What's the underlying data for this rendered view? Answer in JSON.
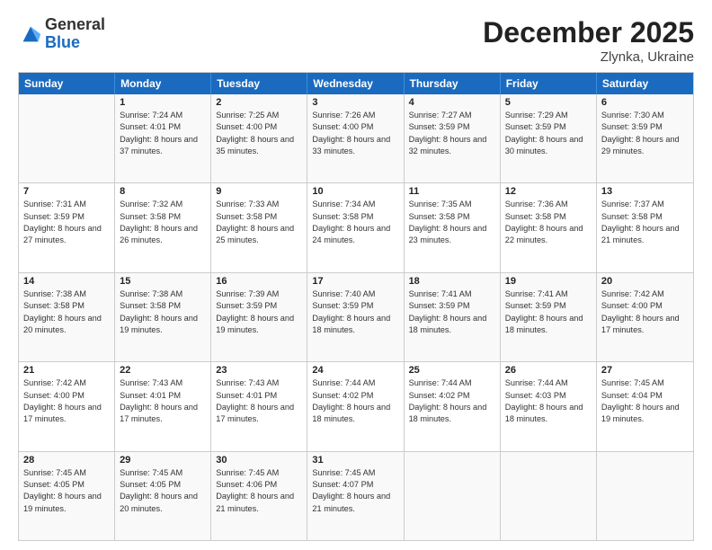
{
  "logo": {
    "general": "General",
    "blue": "Blue"
  },
  "title": "December 2025",
  "subtitle": "Zlynka, Ukraine",
  "header_days": [
    "Sunday",
    "Monday",
    "Tuesday",
    "Wednesday",
    "Thursday",
    "Friday",
    "Saturday"
  ],
  "weeks": [
    [
      {
        "day": "",
        "sunrise": "",
        "sunset": "",
        "daylight": ""
      },
      {
        "day": "1",
        "sunrise": "Sunrise: 7:24 AM",
        "sunset": "Sunset: 4:01 PM",
        "daylight": "Daylight: 8 hours and 37 minutes."
      },
      {
        "day": "2",
        "sunrise": "Sunrise: 7:25 AM",
        "sunset": "Sunset: 4:00 PM",
        "daylight": "Daylight: 8 hours and 35 minutes."
      },
      {
        "day": "3",
        "sunrise": "Sunrise: 7:26 AM",
        "sunset": "Sunset: 4:00 PM",
        "daylight": "Daylight: 8 hours and 33 minutes."
      },
      {
        "day": "4",
        "sunrise": "Sunrise: 7:27 AM",
        "sunset": "Sunset: 3:59 PM",
        "daylight": "Daylight: 8 hours and 32 minutes."
      },
      {
        "day": "5",
        "sunrise": "Sunrise: 7:29 AM",
        "sunset": "Sunset: 3:59 PM",
        "daylight": "Daylight: 8 hours and 30 minutes."
      },
      {
        "day": "6",
        "sunrise": "Sunrise: 7:30 AM",
        "sunset": "Sunset: 3:59 PM",
        "daylight": "Daylight: 8 hours and 29 minutes."
      }
    ],
    [
      {
        "day": "7",
        "sunrise": "Sunrise: 7:31 AM",
        "sunset": "Sunset: 3:59 PM",
        "daylight": "Daylight: 8 hours and 27 minutes."
      },
      {
        "day": "8",
        "sunrise": "Sunrise: 7:32 AM",
        "sunset": "Sunset: 3:58 PM",
        "daylight": "Daylight: 8 hours and 26 minutes."
      },
      {
        "day": "9",
        "sunrise": "Sunrise: 7:33 AM",
        "sunset": "Sunset: 3:58 PM",
        "daylight": "Daylight: 8 hours and 25 minutes."
      },
      {
        "day": "10",
        "sunrise": "Sunrise: 7:34 AM",
        "sunset": "Sunset: 3:58 PM",
        "daylight": "Daylight: 8 hours and 24 minutes."
      },
      {
        "day": "11",
        "sunrise": "Sunrise: 7:35 AM",
        "sunset": "Sunset: 3:58 PM",
        "daylight": "Daylight: 8 hours and 23 minutes."
      },
      {
        "day": "12",
        "sunrise": "Sunrise: 7:36 AM",
        "sunset": "Sunset: 3:58 PM",
        "daylight": "Daylight: 8 hours and 22 minutes."
      },
      {
        "day": "13",
        "sunrise": "Sunrise: 7:37 AM",
        "sunset": "Sunset: 3:58 PM",
        "daylight": "Daylight: 8 hours and 21 minutes."
      }
    ],
    [
      {
        "day": "14",
        "sunrise": "Sunrise: 7:38 AM",
        "sunset": "Sunset: 3:58 PM",
        "daylight": "Daylight: 8 hours and 20 minutes."
      },
      {
        "day": "15",
        "sunrise": "Sunrise: 7:38 AM",
        "sunset": "Sunset: 3:58 PM",
        "daylight": "Daylight: 8 hours and 19 minutes."
      },
      {
        "day": "16",
        "sunrise": "Sunrise: 7:39 AM",
        "sunset": "Sunset: 3:59 PM",
        "daylight": "Daylight: 8 hours and 19 minutes."
      },
      {
        "day": "17",
        "sunrise": "Sunrise: 7:40 AM",
        "sunset": "Sunset: 3:59 PM",
        "daylight": "Daylight: 8 hours and 18 minutes."
      },
      {
        "day": "18",
        "sunrise": "Sunrise: 7:41 AM",
        "sunset": "Sunset: 3:59 PM",
        "daylight": "Daylight: 8 hours and 18 minutes."
      },
      {
        "day": "19",
        "sunrise": "Sunrise: 7:41 AM",
        "sunset": "Sunset: 3:59 PM",
        "daylight": "Daylight: 8 hours and 18 minutes."
      },
      {
        "day": "20",
        "sunrise": "Sunrise: 7:42 AM",
        "sunset": "Sunset: 4:00 PM",
        "daylight": "Daylight: 8 hours and 17 minutes."
      }
    ],
    [
      {
        "day": "21",
        "sunrise": "Sunrise: 7:42 AM",
        "sunset": "Sunset: 4:00 PM",
        "daylight": "Daylight: 8 hours and 17 minutes."
      },
      {
        "day": "22",
        "sunrise": "Sunrise: 7:43 AM",
        "sunset": "Sunset: 4:01 PM",
        "daylight": "Daylight: 8 hours and 17 minutes."
      },
      {
        "day": "23",
        "sunrise": "Sunrise: 7:43 AM",
        "sunset": "Sunset: 4:01 PM",
        "daylight": "Daylight: 8 hours and 17 minutes."
      },
      {
        "day": "24",
        "sunrise": "Sunrise: 7:44 AM",
        "sunset": "Sunset: 4:02 PM",
        "daylight": "Daylight: 8 hours and 18 minutes."
      },
      {
        "day": "25",
        "sunrise": "Sunrise: 7:44 AM",
        "sunset": "Sunset: 4:02 PM",
        "daylight": "Daylight: 8 hours and 18 minutes."
      },
      {
        "day": "26",
        "sunrise": "Sunrise: 7:44 AM",
        "sunset": "Sunset: 4:03 PM",
        "daylight": "Daylight: 8 hours and 18 minutes."
      },
      {
        "day": "27",
        "sunrise": "Sunrise: 7:45 AM",
        "sunset": "Sunset: 4:04 PM",
        "daylight": "Daylight: 8 hours and 19 minutes."
      }
    ],
    [
      {
        "day": "28",
        "sunrise": "Sunrise: 7:45 AM",
        "sunset": "Sunset: 4:05 PM",
        "daylight": "Daylight: 8 hours and 19 minutes."
      },
      {
        "day": "29",
        "sunrise": "Sunrise: 7:45 AM",
        "sunset": "Sunset: 4:05 PM",
        "daylight": "Daylight: 8 hours and 20 minutes."
      },
      {
        "day": "30",
        "sunrise": "Sunrise: 7:45 AM",
        "sunset": "Sunset: 4:06 PM",
        "daylight": "Daylight: 8 hours and 21 minutes."
      },
      {
        "day": "31",
        "sunrise": "Sunrise: 7:45 AM",
        "sunset": "Sunset: 4:07 PM",
        "daylight": "Daylight: 8 hours and 21 minutes."
      },
      {
        "day": "",
        "sunrise": "",
        "sunset": "",
        "daylight": ""
      },
      {
        "day": "",
        "sunrise": "",
        "sunset": "",
        "daylight": ""
      },
      {
        "day": "",
        "sunrise": "",
        "sunset": "",
        "daylight": ""
      }
    ]
  ]
}
